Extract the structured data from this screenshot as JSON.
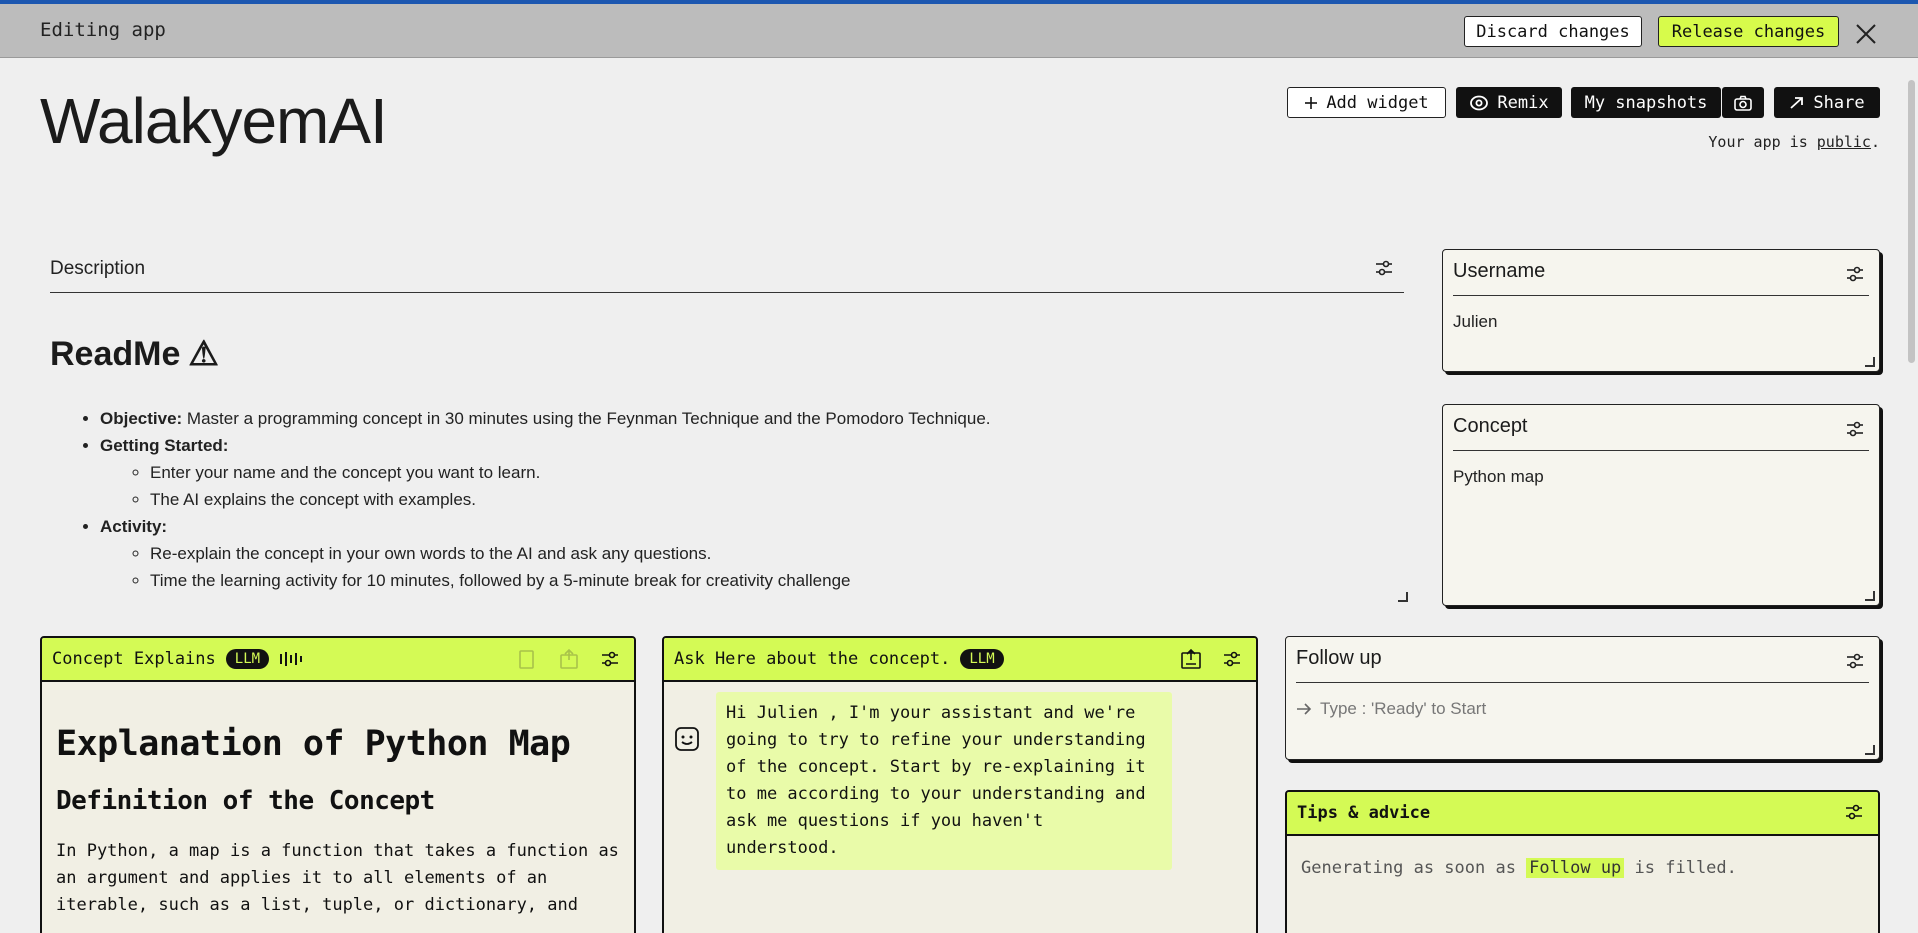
{
  "edit_bar": {
    "title": "Editing app",
    "discard_label": "Discard changes",
    "release_label": "Release changes"
  },
  "header": {
    "app_name": "WalakyemAI",
    "add_widget_label": "Add widget",
    "remix_label": "Remix",
    "snapshots_label": "My snapshots",
    "share_label": "Share",
    "public_prefix": "Your app is ",
    "public_link": "public",
    "public_suffix": "."
  },
  "description": {
    "title": "Description",
    "readme_title": "ReadMe",
    "readme_emoji": "⚠",
    "items": [
      {
        "bold": "Objective:",
        "text": " Master a programming concept in 30 minutes using the Feynman Technique and the Pomodoro Technique."
      },
      {
        "bold": "Getting Started:",
        "text": "",
        "sub": [
          "Enter your name and the concept you want to learn.",
          "The AI explains the concept with examples."
        ]
      },
      {
        "bold": "Activity:",
        "text": "",
        "sub": [
          "Re-explain the concept in your own words to the AI and ask any questions.",
          "Time the learning activity for 10 minutes, followed by a 5-minute break for creativity challenge"
        ]
      }
    ]
  },
  "username_card": {
    "title": "Username",
    "value": "Julien"
  },
  "concept_card": {
    "title": "Concept",
    "value": "Python map"
  },
  "explains_card": {
    "title": "Concept Explains",
    "badge": "LLM",
    "h1": "Explanation of Python Map",
    "h2": "Definition of the Concept",
    "paragraph": "In Python, a map is a function that takes a function as an argument and applies it to all elements of an iterable, such as a list, tuple, or dictionary, and"
  },
  "ask_card": {
    "title": "Ask Here about the concept.",
    "badge": "LLM",
    "message": "Hi Julien , I'm your assistant and we're going to try to refine your understanding of the concept. Start by re-explaining it to me according to your understanding and ask me questions if you haven't understood."
  },
  "followup_card": {
    "title": "Follow up",
    "placeholder": "Type : 'Ready' to Start"
  },
  "tips_card": {
    "title": "Tips & advice",
    "prefix": "Generating as soon as ",
    "highlight": "Follow up",
    "suffix": " is filled."
  },
  "colors": {
    "accent": "#d4fa55",
    "top_border": "#1c57b0",
    "dark": "#111111"
  },
  "icons": [
    "close-icon",
    "plus-icon",
    "remix-icon",
    "camera-icon",
    "share-arrow-icon",
    "settings-sliders-icon",
    "waveform-icon",
    "copy-icon",
    "export-icon",
    "bot-face-icon",
    "arrow-right-icon"
  ]
}
